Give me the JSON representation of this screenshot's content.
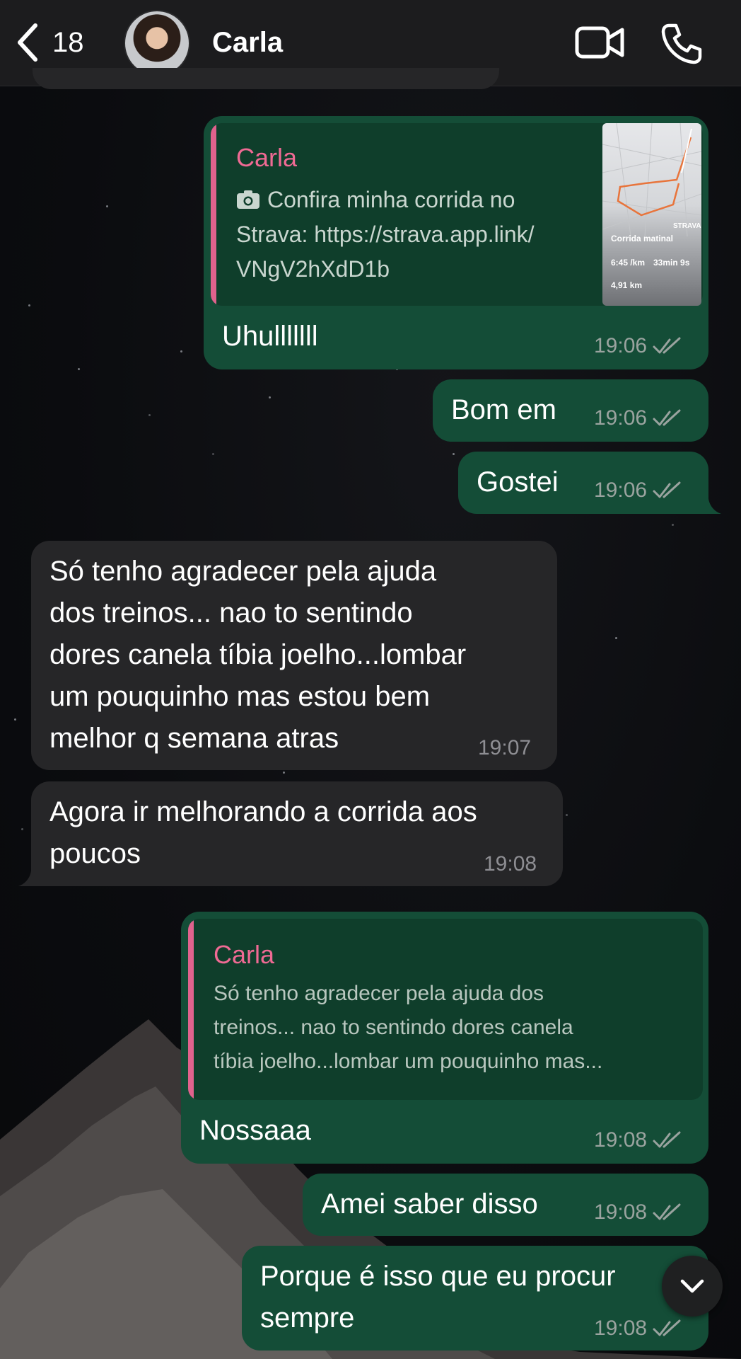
{
  "header": {
    "back_count": "18",
    "contact_name": "Carla"
  },
  "messages": {
    "m1": {
      "quote_author": "Carla",
      "quote_line1": "Confira minha corrida no",
      "quote_line2": "Strava: https://strava.app.link/",
      "quote_line3": "VNgV2hXdD1b",
      "thumb_title": "Corrida matinal",
      "thumb_brand": "STRAVA",
      "thumb_pace": "6:45 /km",
      "thumb_time": "33min 9s",
      "thumb_dist": "4,91 km",
      "text": "Uhulllllll",
      "time": "19:06"
    },
    "m2": {
      "text": "Bom em",
      "time": "19:06"
    },
    "m3": {
      "text": "Gostei",
      "time": "19:06"
    },
    "m4": {
      "line1": "Só tenho  agradecer  pela ajuda",
      "line2": "dos treinos... nao to sentindo",
      "line3": "dores canela  tíbia joelho...lombar",
      "line4": "um pouquinho  mas estou  bem",
      "line5": "melhor q semana atras",
      "time": "19:07"
    },
    "m5": {
      "line1": "Agora ir melhorando a corrida aos",
      "line2": "poucos",
      "time": "19:08"
    },
    "m6": {
      "quote_author": "Carla",
      "quote_line1": "Só tenho  agradecer  pela ajuda dos",
      "quote_line2": "treinos... nao to sentindo dores canela",
      "quote_line3": "tíbia joelho...lombar um pouquinho  mas...",
      "text": "Nossaaa",
      "time": "19:08"
    },
    "m7": {
      "text": "Amei saber disso",
      "time": "19:08"
    },
    "m8": {
      "line1": "Porque é isso que eu procur",
      "line2": "sempre",
      "time": "19:08"
    }
  },
  "colors": {
    "outgoing_bubble": "#144d37",
    "incoming_bubble": "#262628",
    "quote_accent": "#e0628d"
  }
}
